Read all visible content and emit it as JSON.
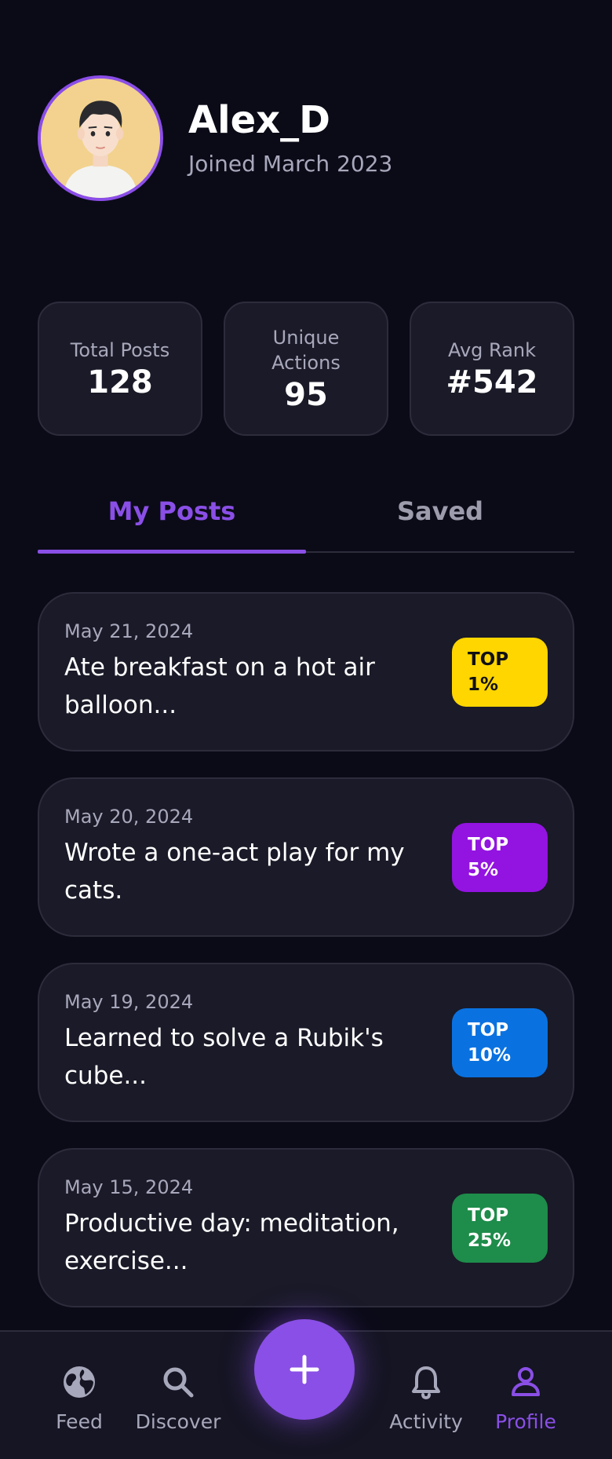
{
  "profile": {
    "username": "Alex_D",
    "joined": "Joined March 2023"
  },
  "stats": [
    {
      "label": "Total Posts",
      "value": "128"
    },
    {
      "label": "Unique Actions",
      "value": "95"
    },
    {
      "label": "Avg Rank",
      "value": "#542"
    }
  ],
  "tabs": [
    {
      "label": "My Posts",
      "active": true
    },
    {
      "label": "Saved",
      "active": false
    }
  ],
  "posts": [
    {
      "date": "May 21, 2024",
      "title": "Ate breakfast on a hot air balloon...",
      "badge_top": "TOP",
      "badge_value": "1%",
      "badge_bg": "#ffd600",
      "badge_fg": "#111111"
    },
    {
      "date": "May 20, 2024",
      "title": "Wrote a one-act play for my cats.",
      "badge_top": "TOP",
      "badge_value": "5%",
      "badge_bg": "#9313e0",
      "badge_fg": "#ffffff"
    },
    {
      "date": "May 19, 2024",
      "title": "Learned to solve a Rubik's cube...",
      "badge_top": "TOP",
      "badge_value": "10%",
      "badge_bg": "#0a72e0",
      "badge_fg": "#ffffff"
    },
    {
      "date": "May 15, 2024",
      "title": "Productive day: meditation, exercise...",
      "badge_top": "TOP",
      "badge_value": "25%",
      "badge_bg": "#1e8c4a",
      "badge_fg": "#ffffff"
    }
  ],
  "nav": {
    "feed": {
      "label": "Feed",
      "icon": "globe-icon"
    },
    "discover": {
      "label": "Discover",
      "icon": "search-icon"
    },
    "activity": {
      "label": "Activity",
      "icon": "bell-icon"
    },
    "profile": {
      "label": "Profile",
      "icon": "person-icon",
      "active": true
    },
    "add": {
      "icon": "plus-icon"
    }
  },
  "colors": {
    "accent": "#8a4fe6",
    "background": "#0b0b18",
    "card": "#1a1a28"
  }
}
